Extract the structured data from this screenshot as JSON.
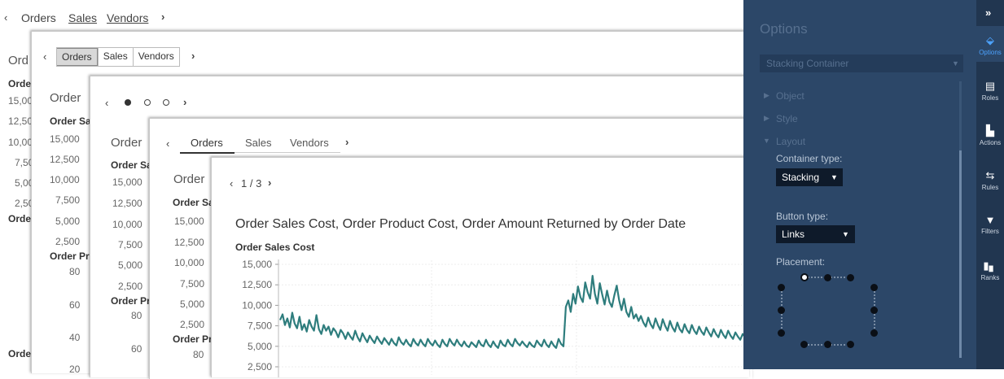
{
  "layer1": {
    "nav": {
      "prev": "‹",
      "tabs": [
        "Orders",
        "Sales",
        "Vendors"
      ],
      "next": "›"
    },
    "title_partial": "Ord",
    "label_partial": "Orde",
    "ticks": [
      "15,00",
      "12,50",
      "10,00",
      "7,50",
      "5,00",
      "2,50"
    ],
    "label2_partial": "Orde",
    "label3_partial": "Orde"
  },
  "layer2": {
    "nav": {
      "prev": "‹",
      "tabs": [
        "Orders",
        "Sales",
        "Vendors"
      ],
      "next": "›"
    },
    "title_partial": "Order",
    "label_partial": "Order Sa",
    "ticks": [
      "15,000",
      "12,500",
      "10,000",
      "7,500",
      "5,000",
      "2,500"
    ],
    "label2_partial": "Order Pr",
    "ticks2": [
      "80",
      "60",
      "40",
      "20"
    ]
  },
  "layer3": {
    "nav": {
      "prev": "‹",
      "next": "›"
    },
    "title_partial": "Order",
    "label_partial": "Order Sa",
    "ticks": [
      "15,000",
      "12,500",
      "10,000",
      "7,500",
      "5,000",
      "2,500"
    ],
    "label2_partial": "Order Pr",
    "ticks2": [
      "80",
      "60"
    ]
  },
  "layer4": {
    "nav": {
      "prev": "‹",
      "tabs": [
        "Orders",
        "Sales",
        "Vendors"
      ],
      "next": "›"
    },
    "title_partial": "Order",
    "label_partial": "Order Sa",
    "ticks": [
      "15,000",
      "12,500",
      "10,000",
      "7,500",
      "5,000",
      "2,500"
    ],
    "label2_partial": "Order Pr",
    "ticks2": [
      "80"
    ]
  },
  "layer5": {
    "nav": {
      "prev": "‹",
      "page": "1 / 3",
      "next": "›"
    },
    "title": "Order Sales Cost, Order Product Cost, Order Amount Returned by Order Date",
    "label": "Order Sales Cost"
  },
  "chart_data": {
    "type": "line",
    "title": "Order Sales Cost, Order Product Cost, Order Amount Returned by Order Date",
    "ylabel": "Order Sales Cost",
    "yticks": [
      "15,000",
      "12,500",
      "10,000",
      "7,500",
      "5,000",
      "2,500"
    ],
    "ylim": [
      2500,
      15000
    ],
    "color": "#2e7d7d",
    "series": [
      {
        "values": [
          8200,
          8900,
          7600,
          8400,
          7300,
          9100,
          7800,
          7200,
          8600,
          7000,
          7700,
          6800,
          8200,
          7400,
          6900,
          8800,
          7100,
          6500,
          7600,
          6900,
          7400,
          6400,
          7200,
          6800,
          6100,
          7000,
          6600,
          5900,
          6700,
          6200,
          5800,
          6900,
          6100,
          5600,
          6600,
          6000,
          5500,
          6300,
          5800,
          5400,
          6200,
          5700,
          5300,
          6000,
          5600,
          5200,
          5900,
          5400,
          5100,
          6100,
          5500,
          5200,
          5800,
          5300,
          5000,
          5900,
          5400,
          5100,
          5800,
          5300,
          5000,
          5900,
          5400,
          5100,
          5700,
          5200,
          4900,
          5800,
          5300,
          5000,
          5900,
          5400,
          5100,
          5800,
          5300,
          5000,
          5600,
          5100,
          4900,
          5500,
          5200,
          4900,
          5700,
          5200,
          5000,
          5800,
          5200,
          4900,
          5600,
          5100,
          4800,
          5700,
          5200,
          5000,
          5800,
          5300,
          5000,
          5900,
          5400,
          5100,
          5600,
          5200,
          4900,
          5500,
          5100,
          4900,
          5700,
          5300,
          5000,
          5800,
          5200,
          4900,
          5600,
          5100,
          4800,
          5900,
          5300,
          5000,
          9800,
          10600,
          9200,
          11400,
          10200,
          12300,
          11000,
          10400,
          12800,
          11600,
          10800,
          13600,
          11400,
          10200,
          12700,
          11300,
          10100,
          11800,
          10400,
          9800,
          11200,
          12400,
          10600,
          9400,
          10800,
          9200,
          8600,
          9800,
          8400,
          8900,
          8100,
          8700,
          7900,
          7400,
          8500,
          7700,
          7200,
          8400,
          7600,
          7000,
          8300,
          7500,
          6900,
          8100,
          7300,
          6800,
          7900,
          7100,
          6700,
          7700,
          7000,
          6600,
          7600,
          6900,
          6500,
          7400,
          6800,
          6400,
          7300,
          6700,
          6200,
          7100,
          6500,
          6100,
          7000,
          6400,
          6000,
          6900,
          6300,
          5900,
          6700,
          6200,
          5800,
          6500,
          6100,
          5700
        ]
      }
    ]
  },
  "panel": {
    "title": "Options",
    "dropdown": "Stacking Container",
    "dropdown_arrow": "▼",
    "sections": [
      "Object",
      "Style",
      "Layout"
    ],
    "container_type_label": "Container type:",
    "container_type_value": "Stacking",
    "button_type_label": "Button type:",
    "button_type_value": "Links",
    "placement_label": "Placement:",
    "caret": "▼"
  },
  "rail": {
    "collapse": "»",
    "items": [
      {
        "label": "Options",
        "icon": "paint-icon"
      },
      {
        "label": "Roles",
        "icon": "roles-icon"
      },
      {
        "label": "Actions",
        "icon": "actions-icon"
      },
      {
        "label": "Rules",
        "icon": "rules-icon"
      },
      {
        "label": "Filters",
        "icon": "filter-icon"
      },
      {
        "label": "Ranks",
        "icon": "ranks-icon"
      }
    ]
  }
}
